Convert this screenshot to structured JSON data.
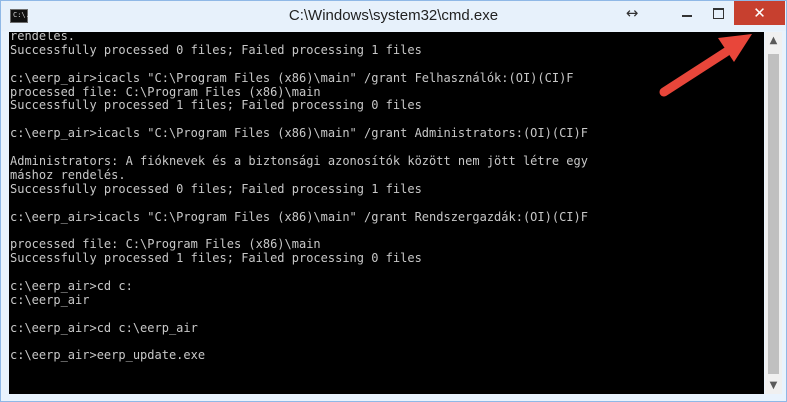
{
  "window": {
    "title": "C:\\Windows\\system32\\cmd.exe",
    "icon": "cmd-icon",
    "icon_text": "C:\\.",
    "controls": {
      "resize": "↔",
      "minimize": "",
      "maximize": "",
      "close": "✕"
    }
  },
  "console": {
    "lines": [
      "rendelés.",
      "Successfully processed 0 files; Failed processing 1 files",
      "",
      "c:\\eerp_air>icacls \"C:\\Program Files (x86)\\main\" /grant Felhasználók:(OI)(CI)F",
      "processed file: C:\\Program Files (x86)\\main",
      "Successfully processed 1 files; Failed processing 0 files",
      "",
      "c:\\eerp_air>icacls \"C:\\Program Files (x86)\\main\" /grant Administrators:(OI)(CI)F",
      "",
      "Administrators: A fióknevek és a biztonsági azonosítók között nem jött létre egy",
      "máshoz rendelés.",
      "Successfully processed 0 files; Failed processing 1 files",
      "",
      "c:\\eerp_air>icacls \"C:\\Program Files (x86)\\main\" /grant Rendszergazdák:(OI)(CI)F",
      "",
      "processed file: C:\\Program Files (x86)\\main",
      "Successfully processed 1 files; Failed processing 0 files",
      "",
      "c:\\eerp_air>cd c:",
      "c:\\eerp_air",
      "",
      "c:\\eerp_air>cd c:\\eerp_air",
      "",
      "c:\\eerp_air>eerp_update.exe"
    ]
  },
  "scrollbar": {
    "up": "▲",
    "down": "▼"
  },
  "colors": {
    "close_bg": "#c7402f",
    "arrow": "#e8463a",
    "console_bg": "#000000",
    "console_text": "#c8c8c8"
  }
}
